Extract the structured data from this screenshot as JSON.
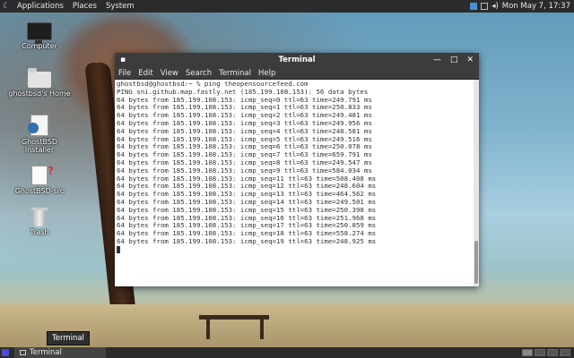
{
  "top_panel": {
    "menus": [
      "Applications",
      "Places",
      "System"
    ],
    "clock": "Mon May  7, 17:37"
  },
  "desktop_icons": [
    {
      "label": "Computer",
      "icon": "computer-icon"
    },
    {
      "label": "ghostbsd's Home",
      "icon": "home-folder-icon"
    },
    {
      "label": "GhostBSD Installer",
      "icon": "installer-icon"
    },
    {
      "label": "GhostBSD-src",
      "icon": "source-help-icon"
    },
    {
      "label": "Trash",
      "icon": "trash-icon"
    }
  ],
  "terminal": {
    "title": "Terminal",
    "menus": [
      "File",
      "Edit",
      "View",
      "Search",
      "Terminal",
      "Help"
    ],
    "prompt_line": "ghostbsd@ghostbsd:~ % ping theopensourcefeed.com",
    "ping_header": "PING sni.github.map.fastly.net (185.199.108.153): 56 data bytes",
    "lines": [
      "64 bytes from 185.199.108.153: icmp_seq=0 ttl=63 time=249.791 ms",
      "64 bytes from 185.199.108.153: icmp_seq=1 ttl=63 time=250.833 ms",
      "64 bytes from 185.199.108.153: icmp_seq=2 ttl=63 time=249.481 ms",
      "64 bytes from 185.199.108.153: icmp_seq=3 ttl=63 time=249.956 ms",
      "64 bytes from 185.199.108.153: icmp_seq=4 ttl=63 time=248.581 ms",
      "64 bytes from 185.199.108.153: icmp_seq=5 ttl=63 time=249.516 ms",
      "64 bytes from 185.199.108.153: icmp_seq=6 ttl=63 time=250.078 ms",
      "64 bytes from 185.199.108.153: icmp_seq=7 ttl=63 time=659.791 ms",
      "64 bytes from 185.199.108.153: icmp_seq=8 ttl=63 time=249.547 ms",
      "64 bytes from 185.199.108.153: icmp_seq=9 ttl=63 time=584.034 ms",
      "64 bytes from 185.199.108.153: icmp_seq=11 ttl=63 time=508.408 ms",
      "64 bytes from 185.199.108.153: icmp_seq=12 ttl=63 time=248.604 ms",
      "64 bytes from 185.199.108.153: icmp_seq=13 ttl=63 time=464.562 ms",
      "64 bytes from 185.199.108.153: icmp_seq=14 ttl=63 time=249.501 ms",
      "64 bytes from 185.199.108.153: icmp_seq=15 ttl=63 time=250.398 ms",
      "64 bytes from 185.199.108.153: icmp_seq=16 ttl=63 time=251.968 ms",
      "64 bytes from 185.199.108.153: icmp_seq=17 ttl=63 time=250.859 ms",
      "64 bytes from 185.199.108.153: icmp_seq=18 ttl=63 time=558.274 ms",
      "64 bytes from 185.199.108.153: icmp_seq=19 ttl=63 time=248.925 ms"
    ]
  },
  "taskbar": {
    "task_label": "Terminal",
    "tooltip": "Terminal"
  },
  "colors": {
    "panel": "#2b2b2b",
    "titlebar": "#3c3c3c",
    "terminal_bg": "#ffffff",
    "terminal_text": "#333333"
  }
}
